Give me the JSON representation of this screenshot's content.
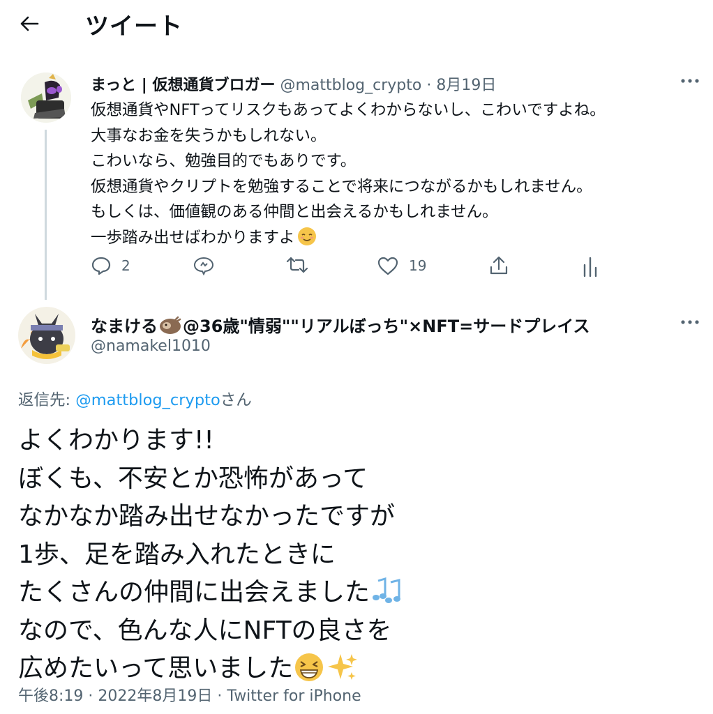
{
  "header": {
    "title": "ツイート"
  },
  "tweet1": {
    "display_name": "まっと | 仮想通貨ブロガー",
    "handle": "@mattblog_crypto",
    "separator": "·",
    "date": "8月19日",
    "lines": [
      "仮想通貨やNFTってリスクもあってよくわからないし、こわいですよね。",
      "大事なお金を失うかもしれない。",
      "こわいなら、勉強目的でもありです。",
      "仮想通貨やクリプトを勉強することで将来につながるかもしれません。",
      "もしくは、価値観のある仲間と出会えるかもしれません。",
      "一歩踏み出せばわかりますよ"
    ],
    "trailing_emoji": "relieved-face",
    "stats": {
      "replies": "2",
      "likes": "19"
    }
  },
  "tweet2": {
    "display_name_a": "なまける",
    "display_name_emoji": "sloth",
    "display_name_b": "@36歳\"情弱\"\"リアルぼっち\"×NFT=サードプレイス",
    "handle": "@namakel1010",
    "reply_prefix": "返信先: ",
    "reply_handle": "@mattblog_crypto",
    "reply_suffix": "さん",
    "lines": [
      "よくわかります!!",
      "ぼくも、不安とか恐怖があって",
      "なかなか踏み出せなかったですが",
      "1歩、足を踏み入れたときに",
      "たくさんの仲間に出会えました",
      "なので、色んな人にNFTの良さを",
      "広めたいって思いました"
    ],
    "line5_emoji": "musical-notes",
    "line7_emojis": [
      "grinning-squinting-face",
      "sparkles"
    ],
    "time": "午後8:19",
    "separator": "·",
    "date": "2022年8月19日",
    "source": "Twitter for iPhone"
  },
  "colors": {
    "accent": "#1d9bf0",
    "muted": "#536471",
    "text": "#0f1419",
    "thread_line": "#cfd9de"
  }
}
